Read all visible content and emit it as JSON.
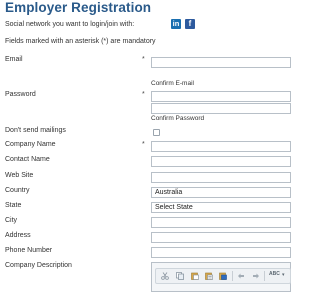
{
  "page": {
    "title": "Employer Registration"
  },
  "social": {
    "label": "Social network you want to login/join with:",
    "linkedin_glyph": "in",
    "facebook_glyph": "f",
    "linkedin_color": "#1a6fb0",
    "facebook_color": "#2d5a9e"
  },
  "form": {
    "mandatory_note": "Fields marked with an asterisk (*) are mandatory",
    "asterisk": "*",
    "labels": {
      "email": "Email",
      "password": "Password",
      "dont_send_mailings": "Don't send mailings",
      "company_name": "Company Name",
      "contact_name": "Contact Name",
      "web_site": "Web Site",
      "country": "Country",
      "state": "State",
      "city": "City",
      "address": "Address",
      "phone_number": "Phone Number",
      "company_description": "Company Description"
    },
    "sublabels": {
      "confirm_email": "Confirm E-mail",
      "confirm_password": "Confirm Password"
    },
    "values": {
      "email": "",
      "confirm_email": "",
      "password": "",
      "confirm_password": "",
      "company_name": "",
      "contact_name": "",
      "web_site": "",
      "country": "Australia",
      "state": "Select State",
      "city": "",
      "address": "",
      "phone_number": ""
    },
    "dont_send_mailings_checked": false
  },
  "editor_toolbar": {
    "icons": [
      "cut-icon",
      "copy-icon",
      "paste-icon",
      "paste-text-icon",
      "paste-word-icon",
      "undo-icon",
      "redo-icon",
      "spellcheck-icon"
    ],
    "spellcheck_glyph": "ABC"
  }
}
